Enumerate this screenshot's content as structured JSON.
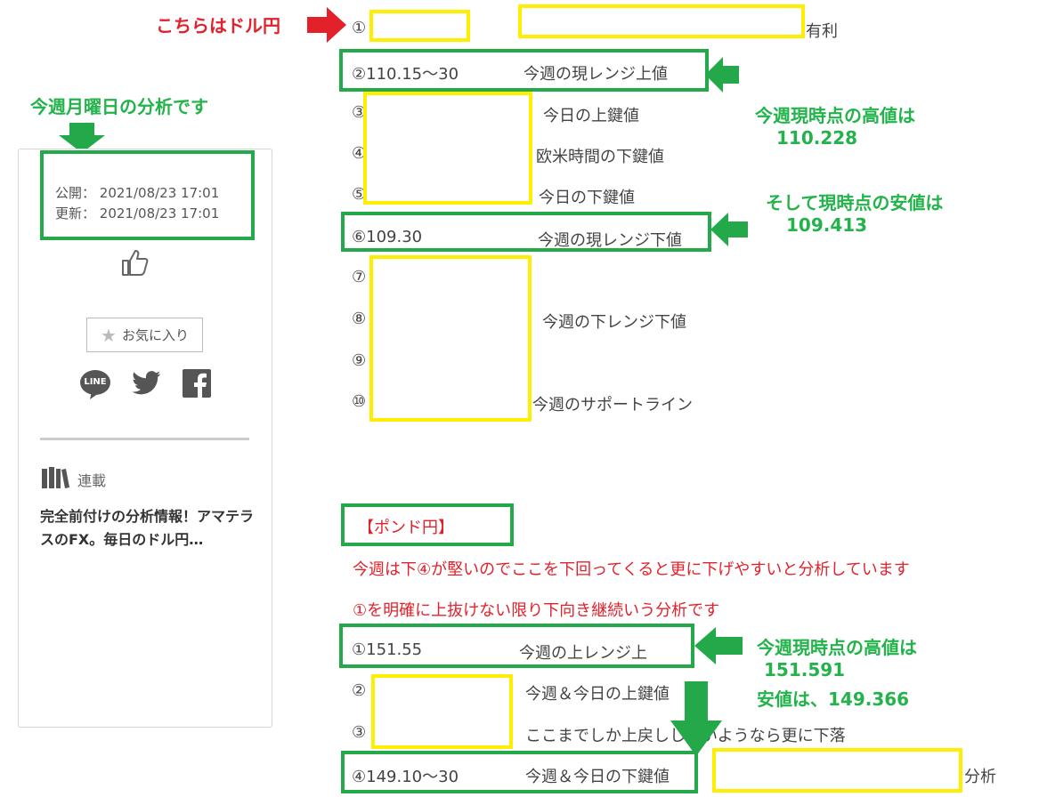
{
  "annotations": {
    "dollar_yen_pointer": "こちらはドル円",
    "monday_analysis": "今週月曜日の分析です",
    "usd_high_title": "今週現時点の高値は",
    "usd_high_value": "110.228",
    "usd_low_title": "そして現時点の安値は",
    "usd_low_value": "109.413",
    "gbp_high_title": "今週現時点の高値は",
    "gbp_high_value": "151.591",
    "gbp_low_line": "安値は、149.366"
  },
  "sidebar": {
    "published_label": "公開：",
    "published_value": "2021/08/23 17:01",
    "updated_label": "更新：",
    "updated_value": "2021/08/23 17:01",
    "favorite_label": "お気に入り",
    "line_label": "LINE",
    "series_label": "連載",
    "series_title": "完全前付けの分析情報！アマテラスのFX。毎日のドル円…"
  },
  "usd_jpy": {
    "rows": [
      {
        "mark": "①",
        "value": "",
        "label": "有利"
      },
      {
        "mark": "②",
        "value": "110.15～30",
        "label": "今週の現レンジ上値"
      },
      {
        "mark": "③",
        "value": "",
        "label": "今日の上鍵値"
      },
      {
        "mark": "④",
        "value": "",
        "label": "欧米時間の下鍵値"
      },
      {
        "mark": "⑤",
        "value": "",
        "label": "今日の下鍵値"
      },
      {
        "mark": "⑥",
        "value": "109.30",
        "label": "今週の現レンジ下値"
      },
      {
        "mark": "⑦",
        "value": "",
        "label": ""
      },
      {
        "mark": "⑧",
        "value": "",
        "label": "今週の下レンジ下値"
      },
      {
        "mark": "⑨",
        "value": "",
        "label": ""
      },
      {
        "mark": "⑩",
        "value": "",
        "label": "今週のサポートライン"
      }
    ]
  },
  "gbp_jpy": {
    "heading": "【ポンド円】",
    "note1": "今週は下④が堅いのでここを下回ってくると更に下げやすいと分析しています",
    "note2": "①を明確に上抜けない限り下向き継続いう分析です",
    "rows": [
      {
        "mark": "①",
        "value": "151.55",
        "label": "今週の上レンジ上"
      },
      {
        "mark": "②",
        "value": "",
        "label": "今週＆今日の上鍵値"
      },
      {
        "mark": "③",
        "value": "",
        "label": "ここまでしか上戻ししないようなら更に下落"
      },
      {
        "mark": "④",
        "value": "149.10～30",
        "label": "今週＆今日の下鍵値"
      }
    ],
    "trailing_label": "分析"
  },
  "colors": {
    "green": "#23a94a",
    "yellow": "#ffee00",
    "red": "#e3212b"
  }
}
